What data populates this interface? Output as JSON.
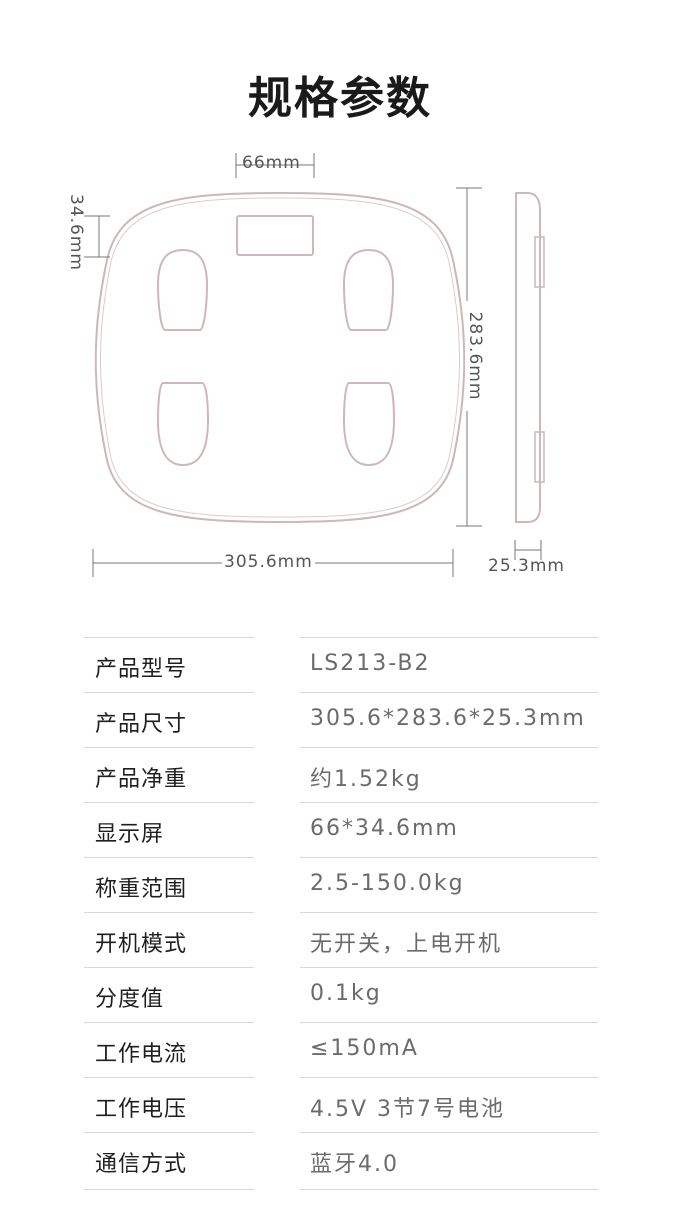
{
  "title": "规格参数",
  "dimensions": {
    "width": "305.6mm",
    "height": "283.6mm",
    "depth": "25.3mm",
    "display_width": "66mm",
    "display_height": "34.6mm"
  },
  "specs": [
    {
      "label": "产品型号",
      "value": "LS213-B2"
    },
    {
      "label": "产品尺寸",
      "value": "305.6*283.6*25.3mm"
    },
    {
      "label": "产品净重",
      "value": "约1.52kg"
    },
    {
      "label": "显示屏",
      "value": "66*34.6mm"
    },
    {
      "label": "称重范围",
      "value": "2.5-150.0kg"
    },
    {
      "label": "开机模式",
      "value": "无开关，上电开机"
    },
    {
      "label": "分度值",
      "value": "0.1kg"
    },
    {
      "label": "工作电流",
      "value": "≤150mA"
    },
    {
      "label": "工作电压",
      "value": "4.5V 3节7号电池"
    },
    {
      "label": "通信方式",
      "value": "蓝牙4.0"
    }
  ]
}
